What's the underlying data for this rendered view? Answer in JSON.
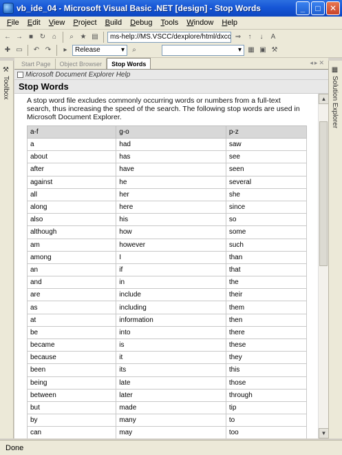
{
  "window": {
    "title": "vb_ide_04 - Microsoft Visual Basic .NET [design] - Stop Words"
  },
  "menu": [
    "File",
    "Edit",
    "View",
    "Project",
    "Build",
    "Debug",
    "Tools",
    "Window",
    "Help"
  ],
  "toolbar1": {
    "url": "ms-help://MS.VSCC/dexplore/html/dxcon"
  },
  "toolbar2": {
    "config": "Release"
  },
  "side": {
    "toolbox": "Toolbox",
    "solution": "Solution Explorer"
  },
  "tabs": [
    {
      "label": "Start Page"
    },
    {
      "label": "Object Browser"
    },
    {
      "label": "Stop Words"
    }
  ],
  "content": {
    "banner": "Microsoft Document Explorer Help",
    "heading": "Stop Words",
    "intro": "A stop word file excludes commonly occurring words or numbers from a full-text search, thus increasing the speed of the search. The following stop words are used in Microsoft Document Explorer.",
    "columns": [
      "a-f",
      "g-o",
      "p-z"
    ],
    "rows": [
      [
        "a",
        "had",
        "saw"
      ],
      [
        "about",
        "has",
        "see"
      ],
      [
        "after",
        "have",
        "seen"
      ],
      [
        "against",
        "he",
        "several"
      ],
      [
        "all",
        "her",
        "she"
      ],
      [
        "along",
        "here",
        "since"
      ],
      [
        "also",
        "his",
        "so"
      ],
      [
        "although",
        "how",
        "some"
      ],
      [
        "am",
        "however",
        "such"
      ],
      [
        "among",
        "I",
        "than"
      ],
      [
        "an",
        "if",
        "that"
      ],
      [
        "and",
        "in",
        "the"
      ],
      [
        "are",
        "include",
        "their"
      ],
      [
        "as",
        "including",
        "them"
      ],
      [
        "at",
        "information",
        "then"
      ],
      [
        "be",
        "into",
        "there"
      ],
      [
        "became",
        "is",
        "these"
      ],
      [
        "because",
        "it",
        "they"
      ],
      [
        "been",
        "its",
        "this"
      ],
      [
        "being",
        "late",
        "those"
      ],
      [
        "between",
        "later",
        "through"
      ],
      [
        "but",
        "made",
        "tip"
      ],
      [
        "by",
        "many",
        "to"
      ],
      [
        "can",
        "may",
        "too"
      ]
    ]
  },
  "status": {
    "text": "Done"
  }
}
